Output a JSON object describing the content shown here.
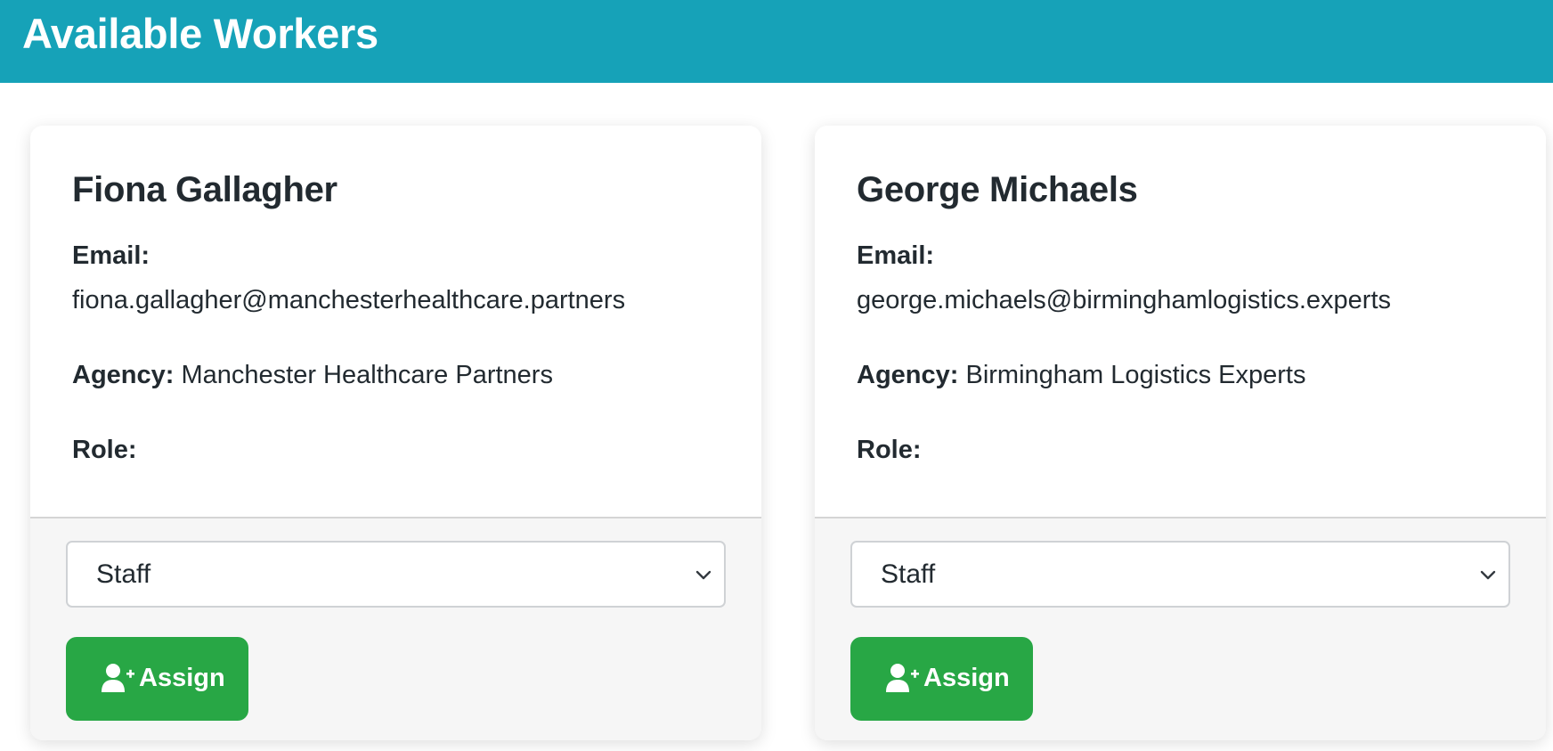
{
  "header": {
    "title": "Available Workers"
  },
  "labels": {
    "email": "Email:",
    "agency": "Agency:",
    "role": "Role:"
  },
  "workers": [
    {
      "name": "Fiona Gallagher",
      "email": "fiona.gallagher@manchesterhealthcare.partners",
      "agency": "Manchester Healthcare Partners",
      "role_select_value": "Staff",
      "assign_label": "Assign"
    },
    {
      "name": "George Michaels",
      "email": "george.michaels@birminghamlogistics.experts",
      "agency": "Birmingham Logistics Experts",
      "role_select_value": "Staff",
      "assign_label": "Assign"
    }
  ],
  "colors": {
    "header_bg": "#16a2b8",
    "assign_button_bg": "#28a745",
    "card_footer_bg": "#f6f6f6",
    "text": "#222a30"
  },
  "icons": {
    "assign": "user-plus-icon",
    "select": "chevron-down-icon"
  }
}
